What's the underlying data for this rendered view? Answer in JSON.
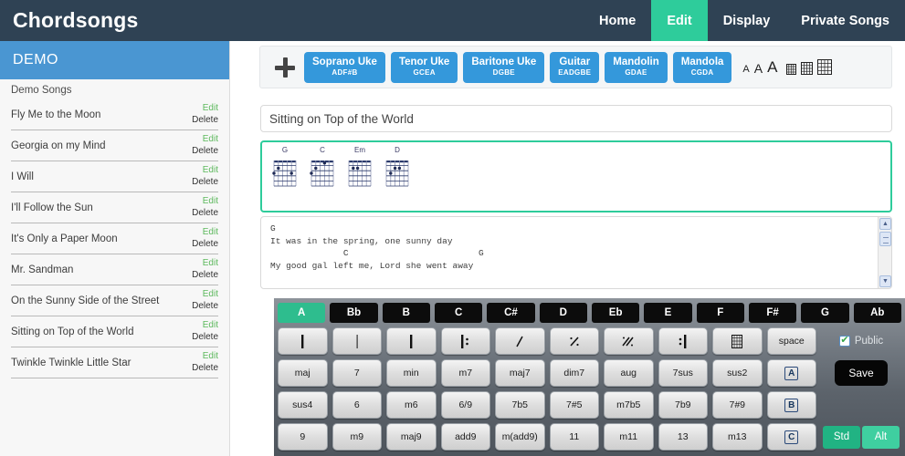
{
  "nav": {
    "brand": "Chordsongs",
    "items": [
      {
        "label": "Home",
        "active": false
      },
      {
        "label": "Edit",
        "active": true
      },
      {
        "label": "Display",
        "active": false
      },
      {
        "label": "Private Songs",
        "active": false
      }
    ],
    "accent": "#2ecc9b",
    "bar_color": "#2f4254"
  },
  "sidebar": {
    "header": "DEMO",
    "header_color": "#4a96d2",
    "group_label": "Demo Songs",
    "edit_label": "Edit",
    "delete_label": "Delete",
    "songs": [
      {
        "title": "Fly Me to the Moon"
      },
      {
        "title": "Georgia on my Mind"
      },
      {
        "title": "I Will"
      },
      {
        "title": "I'll Follow the Sun"
      },
      {
        "title": "It's Only a Paper Moon"
      },
      {
        "title": "Mr. Sandman"
      },
      {
        "title": "On the Sunny Side of the Street"
      },
      {
        "title": "Sitting on Top of the World"
      },
      {
        "title": "Twinkle Twinkle Little Star"
      }
    ]
  },
  "toolbar": {
    "add_icon": "plus-icon",
    "instruments": [
      {
        "name": "Soprano Uke",
        "tuning": "ADF#B"
      },
      {
        "name": "Tenor Uke",
        "tuning": "GCEA"
      },
      {
        "name": "Baritone Uke",
        "tuning": "DGBE"
      },
      {
        "name": "Guitar",
        "tuning": "EADGBE"
      },
      {
        "name": "Mandolin",
        "tuning": "GDAE"
      },
      {
        "name": "Mandola",
        "tuning": "CGDA"
      }
    ],
    "instrument_color": "#3498db",
    "font_sizes": [
      "A",
      "A",
      "A"
    ],
    "grid_icons": [
      "grid-small-icon",
      "grid-medium-icon",
      "grid-large-icon"
    ]
  },
  "song": {
    "title_value": "Sitting on Top of the World",
    "title_placeholder": "Song title",
    "chords": [
      {
        "name": "G",
        "dots": [
          [
            2,
            2
          ],
          [
            1,
            3
          ],
          [
            5,
            3
          ]
        ],
        "open": []
      },
      {
        "name": "C",
        "dots": [
          [
            2,
            2
          ],
          [
            4,
            1
          ],
          [
            1,
            3
          ]
        ],
        "open": []
      },
      {
        "name": "Em",
        "dots": [
          [
            2,
            2
          ],
          [
            3,
            2
          ]
        ],
        "open": []
      },
      {
        "name": "D",
        "dots": [
          [
            3,
            2
          ],
          [
            4,
            2
          ],
          [
            2,
            3
          ]
        ],
        "open": []
      }
    ],
    "lyrics": "G\nIt was in the spring, one sunny day\n              C                         G\nMy good gal left me, Lord she went away"
  },
  "keyboard": {
    "roots": [
      "A",
      "Bb",
      "B",
      "C",
      "C#",
      "D",
      "Eb",
      "E",
      "F",
      "F#",
      "G",
      "Ab"
    ],
    "selected_root": "A",
    "symbols": [
      {
        "glyph": "bar-line",
        "name": "barline-thick-icon"
      },
      {
        "glyph": "thin-bar",
        "name": "barline-thin-icon"
      },
      {
        "glyph": "bar-line",
        "name": "barline-thick-2-icon"
      },
      {
        "glyph": "repeat-start",
        "name": "repeat-start-icon"
      },
      {
        "glyph": "slash",
        "name": "slash-icon"
      },
      {
        "glyph": "repeat-1",
        "name": "repeat-measure-icon"
      },
      {
        "glyph": "repeat-2",
        "name": "repeat-two-measure-icon"
      },
      {
        "glyph": "repeat-end",
        "name": "repeat-end-icon"
      },
      {
        "glyph": "chord-grid",
        "name": "chord-grid-icon"
      },
      {
        "glyph": "space",
        "name": "space-key"
      }
    ],
    "space_label": "space",
    "modifiers_row1": [
      "maj",
      "7",
      "min",
      "m7",
      "maj7",
      "dim7",
      "aug",
      "7sus",
      "sus2"
    ],
    "modifiers_row2": [
      "sus4",
      "6",
      "m6",
      "6/9",
      "7b5",
      "7#5",
      "m7b5",
      "7b9",
      "7#9"
    ],
    "modifiers_row3": [
      "9",
      "m9",
      "maj9",
      "add9",
      "m(add9)",
      "11",
      "m11",
      "13",
      "m13"
    ],
    "section_keys": [
      "A",
      "B",
      "C"
    ],
    "public_label": "Public",
    "public_checked": true,
    "save_label": "Save",
    "std_label": "Std",
    "alt_label": "Alt"
  }
}
